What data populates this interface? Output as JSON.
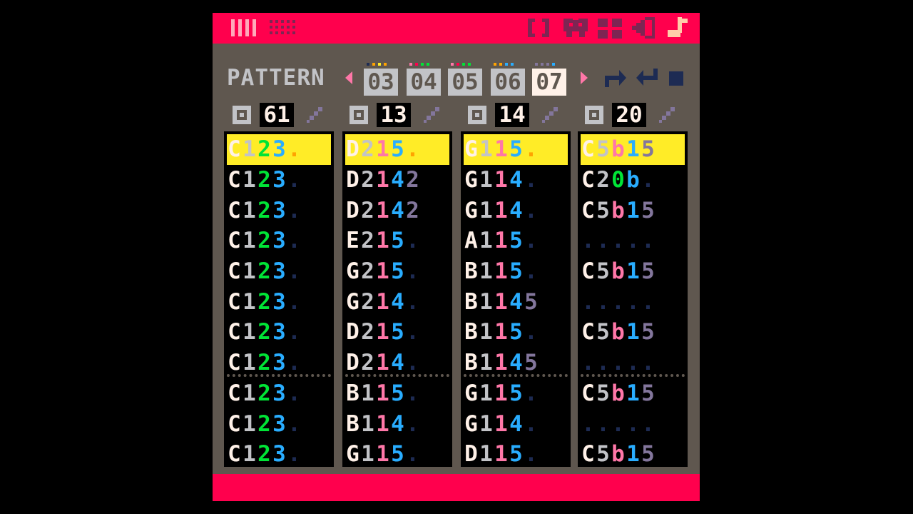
{
  "colors": {
    "bg": "#000000",
    "panel": "#5f574f",
    "topbar": "#ff004d",
    "light": "#c2c3c7",
    "white": "#fff1e8",
    "highlight": "#ffec27",
    "green": "#00e436",
    "blue": "#29adff",
    "pink": "#ff77a8",
    "lavender": "#83769c",
    "navy": "#1d2b53"
  },
  "toolbar": {
    "left_icons": [
      "sfx-bars-icon",
      "music-grid-icon"
    ],
    "right_icons": [
      "code-braces-icon",
      "sprite-creature-icon",
      "map-tiles-icon",
      "sfx-speaker-icon",
      "music-note-icon"
    ]
  },
  "pattern": {
    "label": "PATTERN",
    "slots": [
      "03",
      "04",
      "05",
      "06",
      "07"
    ],
    "selected_index": 4,
    "controls": [
      "loop-start-icon",
      "loop-back-icon",
      "stop-icon"
    ]
  },
  "channels": [
    {
      "number": "61",
      "rows": [
        [
          "C",
          "1",
          "2",
          "3",
          "."
        ],
        [
          "C",
          "1",
          "2",
          "3",
          "."
        ],
        [
          "C",
          "1",
          "2",
          "3",
          "."
        ],
        [
          "C",
          "1",
          "2",
          "3",
          "."
        ],
        [
          "C",
          "1",
          "2",
          "3",
          "."
        ],
        [
          "C",
          "1",
          "2",
          "3",
          "."
        ],
        [
          "C",
          "1",
          "2",
          "3",
          "."
        ],
        [
          "C",
          "1",
          "2",
          "3",
          "."
        ],
        [
          "C",
          "1",
          "2",
          "3",
          "."
        ],
        [
          "C",
          "1",
          "2",
          "3",
          "."
        ],
        [
          "C",
          "1",
          "2",
          "3",
          "."
        ]
      ]
    },
    {
      "number": "13",
      "rows": [
        [
          "D",
          "2",
          "1",
          "5",
          "."
        ],
        [
          "D",
          "2",
          "1",
          "4",
          "2"
        ],
        [
          "D",
          "2",
          "1",
          "4",
          "2"
        ],
        [
          "E",
          "2",
          "1",
          "5",
          "."
        ],
        [
          "G",
          "2",
          "1",
          "5",
          "."
        ],
        [
          "G",
          "2",
          "1",
          "4",
          "."
        ],
        [
          "D",
          "2",
          "1",
          "5",
          "."
        ],
        [
          "D",
          "2",
          "1",
          "4",
          "."
        ],
        [
          "B",
          "1",
          "1",
          "5",
          "."
        ],
        [
          "B",
          "1",
          "1",
          "4",
          "."
        ],
        [
          "G",
          "1",
          "1",
          "5",
          "."
        ]
      ]
    },
    {
      "number": "14",
      "rows": [
        [
          "G",
          "1",
          "1",
          "5",
          "."
        ],
        [
          "G",
          "1",
          "1",
          "4",
          "."
        ],
        [
          "G",
          "1",
          "1",
          "4",
          "."
        ],
        [
          "A",
          "1",
          "1",
          "5",
          "."
        ],
        [
          "B",
          "1",
          "1",
          "5",
          "."
        ],
        [
          "B",
          "1",
          "1",
          "4",
          "5"
        ],
        [
          "B",
          "1",
          "1",
          "5",
          "."
        ],
        [
          "B",
          "1",
          "1",
          "4",
          "5"
        ],
        [
          "G",
          "1",
          "1",
          "5",
          "."
        ],
        [
          "G",
          "1",
          "1",
          "4",
          "."
        ],
        [
          "D",
          "1",
          "1",
          "5",
          "."
        ]
      ]
    },
    {
      "number": "20",
      "rows": [
        [
          "C",
          "5",
          "b",
          "1",
          "5"
        ],
        [
          "C",
          "2",
          "0",
          "b",
          "."
        ],
        [
          "C",
          "5",
          "b",
          "1",
          "5"
        ],
        [
          ".",
          ".",
          ".",
          ".",
          "."
        ],
        [
          "C",
          "5",
          "b",
          "1",
          "5"
        ],
        [
          ".",
          ".",
          ".",
          ".",
          "."
        ],
        [
          "C",
          "5",
          "b",
          "1",
          "5"
        ],
        [
          ".",
          ".",
          ".",
          ".",
          "."
        ],
        [
          "C",
          "5",
          "b",
          "1",
          "5"
        ],
        [
          ".",
          ".",
          ".",
          ".",
          "."
        ],
        [
          "C",
          "5",
          "b",
          "1",
          "5"
        ]
      ]
    }
  ]
}
